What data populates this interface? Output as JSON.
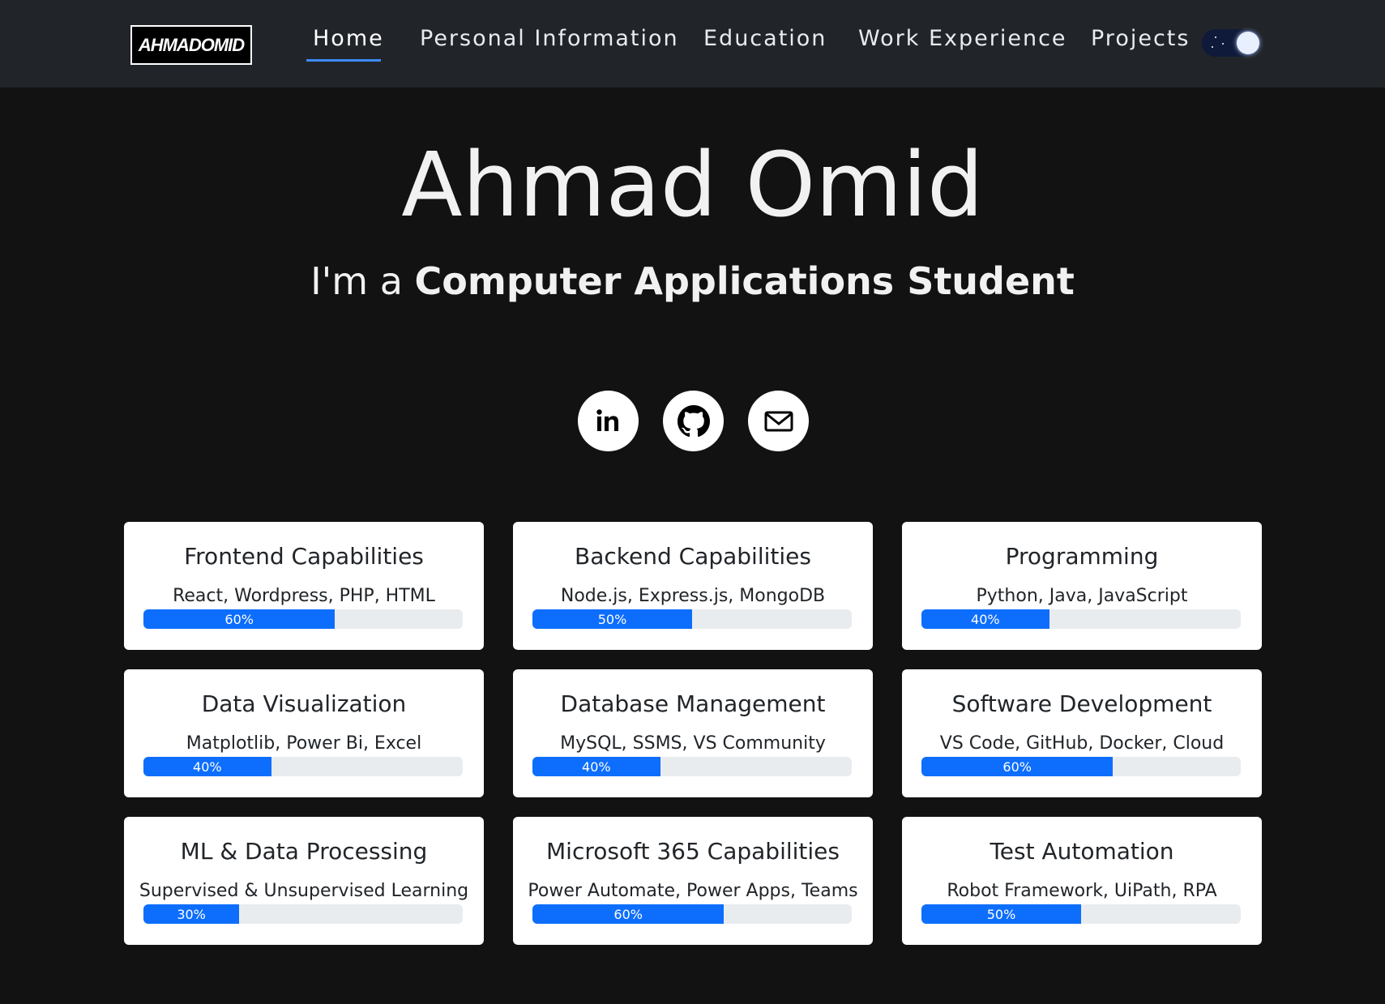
{
  "nav": {
    "logo": "AHMADOMID",
    "links": [
      "Home",
      "Personal Information",
      "Education",
      "Work Experience",
      "Projects"
    ],
    "active": "Home",
    "theme_toggle": "dark"
  },
  "hero": {
    "name": "Ahmad Omid",
    "subtitle_prefix": "I'm a ",
    "subtitle_role": "Computer Applications Student"
  },
  "social": [
    {
      "icon": "linkedin-icon"
    },
    {
      "icon": "github-icon"
    },
    {
      "icon": "mail-icon"
    }
  ],
  "skills": [
    {
      "title": "Frontend Capabilities",
      "desc": "React, Wordpress, PHP, HTML",
      "percent": 60,
      "label": "60%"
    },
    {
      "title": "Backend Capabilities",
      "desc": "Node.js, Express.js, MongoDB",
      "percent": 50,
      "label": "50%"
    },
    {
      "title": "Programming",
      "desc": "Python, Java, JavaScript",
      "percent": 40,
      "label": "40%"
    },
    {
      "title": "Data Visualization",
      "desc": "Matplotlib, Power Bi, Excel",
      "percent": 40,
      "label": "40%"
    },
    {
      "title": "Database Management",
      "desc": "MySQL, SSMS, VS Community",
      "percent": 40,
      "label": "40%"
    },
    {
      "title": "Software Development",
      "desc": "VS Code, GitHub, Docker, Cloud",
      "percent": 60,
      "label": "60%"
    },
    {
      "title": "ML & Data Processing",
      "desc": "Supervised & Unsupervised Learning",
      "percent": 30,
      "label": "30%"
    },
    {
      "title": "Microsoft 365 Capabilities",
      "desc": "Power Automate, Power Apps, Teams",
      "percent": 60,
      "label": "60%"
    },
    {
      "title": "Test Automation",
      "desc": "Robot Framework, UiPath, RPA",
      "percent": 50,
      "label": "50%"
    }
  ],
  "colors": {
    "navbar": "#212529",
    "background": "#121212",
    "accent": "#0d6efd",
    "track": "#e9ecef"
  }
}
